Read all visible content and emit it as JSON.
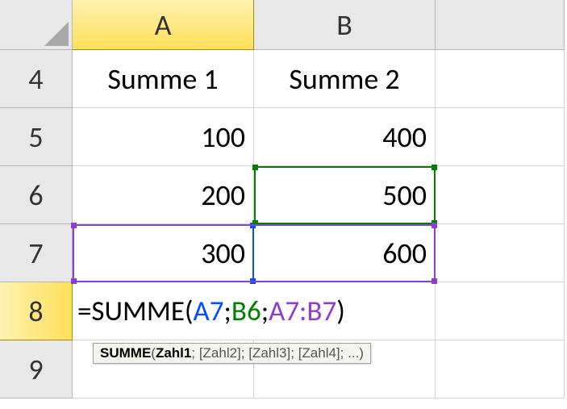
{
  "columns": {
    "A": "A",
    "B": "B"
  },
  "rows": {
    "4": "4",
    "5": "5",
    "6": "6",
    "7": "7",
    "8": "8",
    "9": "9"
  },
  "cells": {
    "A4": "Summe 1",
    "B4": "Summe 2",
    "A5": "100",
    "B5": "400",
    "A6": "200",
    "B6": "500",
    "A7": "300",
    "B7": "600"
  },
  "formula": {
    "prefix": "=SUMME(",
    "ref1": "A7",
    "sep1": ";",
    "ref2": "B6",
    "sep2": ";",
    "ref3": "A7:B7",
    "suffix": ")"
  },
  "tooltip": {
    "fn": "SUMME",
    "sig_open": "(",
    "p1": "Zahl1",
    "sep": "; ",
    "p2": "[Zahl2]",
    "p3": "[Zahl3]",
    "p4": "[Zahl4]",
    "rest": "; ...)"
  },
  "chart_data": {
    "type": "table",
    "columns": [
      "Summe 1",
      "Summe 2"
    ],
    "rows": [
      [
        100,
        400
      ],
      [
        200,
        500
      ],
      [
        300,
        600
      ]
    ],
    "formula_row": "=SUMME(A7;B6;A7:B7)"
  }
}
